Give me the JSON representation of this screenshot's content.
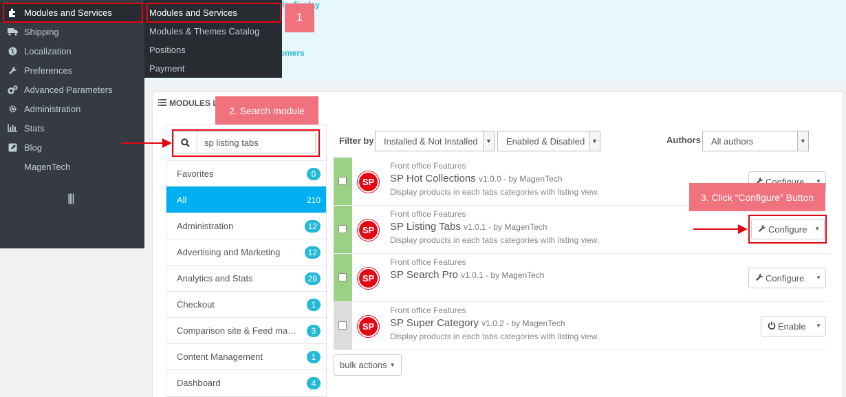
{
  "top_peek": [
    "Simple HTML table display",
    "...",
    "Customers"
  ],
  "sidebar": {
    "items": [
      {
        "label": "Modules and Services",
        "icon": "puzzle-icon",
        "active": true
      },
      {
        "label": "Shipping",
        "icon": "truck-icon"
      },
      {
        "label": "Localization",
        "icon": "globe-icon"
      },
      {
        "label": "Preferences",
        "icon": "wrench-icon"
      },
      {
        "label": "Advanced Parameters",
        "icon": "cogs-icon"
      },
      {
        "label": "Administration",
        "icon": "gear-icon"
      },
      {
        "label": "Stats",
        "icon": "bar-chart-icon"
      },
      {
        "label": "Blog",
        "icon": "edit-icon"
      },
      {
        "label": "MagenTech",
        "icon": ""
      }
    ]
  },
  "submenu": {
    "items": [
      {
        "label": "Modules and Services",
        "active": true
      },
      {
        "label": "Modules & Themes Catalog"
      },
      {
        "label": "Positions"
      },
      {
        "label": "Payment"
      }
    ]
  },
  "callouts": {
    "step1": "1",
    "step2": "2. Search module",
    "step3": "3. Click “Configure” Button"
  },
  "panel": {
    "heading": "MODULES LIS"
  },
  "search": {
    "value": "sp listing tabs"
  },
  "categories": [
    {
      "name": "Favorites",
      "count": "0"
    },
    {
      "name": "All",
      "count": "210",
      "active": true
    },
    {
      "name": "Administration",
      "count": "12"
    },
    {
      "name": "Advertising and Marketing",
      "count": "12"
    },
    {
      "name": "Analytics and Stats",
      "count": "28"
    },
    {
      "name": "Checkout",
      "count": "1"
    },
    {
      "name": "Comparison site & Feed mana...",
      "count": "3"
    },
    {
      "name": "Content Management",
      "count": "1"
    },
    {
      "name": "Dashboard",
      "count": "4"
    }
  ],
  "filter": {
    "label": "Filter by",
    "install_select": "Installed & Not Installed",
    "enable_select": "Enabled & Disabled",
    "authors_label": "Authors",
    "authors_select": "All authors"
  },
  "modules": [
    {
      "category": "Front office Features",
      "name": "SP Hot Collections",
      "version": "v1.0.0 - by MagenTech",
      "desc": "Display products in each tabs categories with listing view.",
      "action": "Configure",
      "status_color": "#9ad184"
    },
    {
      "category": "Front office Features",
      "name": "SP Listing Tabs",
      "version": "v1.0.1 - by MagenTech",
      "desc": "Display products in each tabs categories with listing view.",
      "action": "Configure",
      "status_color": "#9ad184"
    },
    {
      "category": "Front office Features",
      "name": "SP Search Pro",
      "version": "v1.0.1 - by MagenTech",
      "desc": "",
      "action": "Configure",
      "status_color": "#9ad184"
    },
    {
      "category": "Front office Features",
      "name": "SP Super Category",
      "version": "v1.0.2 - by MagenTech",
      "desc": "Display products in each tabs categories with listing view.",
      "action": "Enable",
      "status_color": "#dcdcdc"
    }
  ],
  "logo_text": "SP",
  "bulk_actions": "bulk actions",
  "colors": {
    "accent": "#25b9d7",
    "active_category": "#00aff0",
    "highlight": "#e30613",
    "callout": "#f0727d"
  }
}
